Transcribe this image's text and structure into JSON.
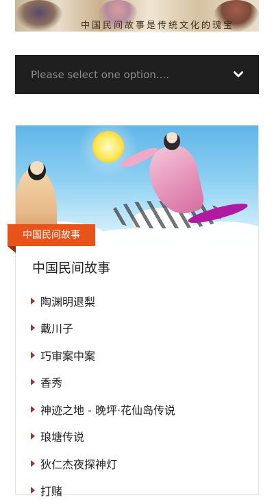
{
  "banner": {
    "text": "中国民间故事是传统文化的瑰宝"
  },
  "select": {
    "placeholder": "Please select one option....",
    "icon": "chevron-down-icon"
  },
  "card": {
    "category_tag": "中国民间故事",
    "title": "中国民间故事",
    "items": [
      {
        "label": "陶渊明退梨"
      },
      {
        "label": "戴川子"
      },
      {
        "label": "巧审案中案"
      },
      {
        "label": "香秀"
      },
      {
        "label": "神迹之地 - 晚坪·花仙岛传说"
      },
      {
        "label": "琅塘传说"
      },
      {
        "label": "狄仁杰夜探神灯"
      },
      {
        "label": "打赌"
      }
    ]
  },
  "colors": {
    "select_bg": "#1f1f1f",
    "tag_bg": "#e8531a",
    "bullet": "#a0341e"
  }
}
